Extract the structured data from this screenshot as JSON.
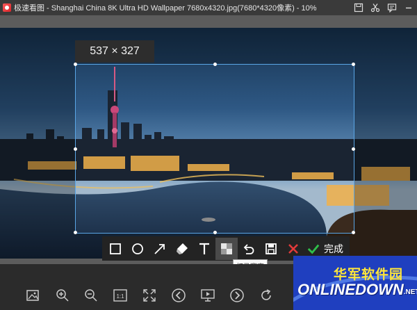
{
  "titlebar": {
    "title": "极速看图 - Shanghai China 8K Ultra HD Wallpaper 7680x4320.jpg(7680*4320像素) - 10%",
    "icons": [
      "save-icon",
      "crop-icon",
      "comment-icon",
      "minimize-icon"
    ]
  },
  "selection": {
    "size_label": "537 × 327"
  },
  "toolbar": {
    "tools": [
      "rectangle-icon",
      "ellipse-icon",
      "arrow-icon",
      "brush-icon",
      "text-icon",
      "mosaic-icon",
      "undo-icon",
      "save-icon",
      "cancel-icon"
    ],
    "done_label": "完成",
    "tooltip": "打马赛克"
  },
  "bottom_bar": {
    "icons": [
      "image-icon",
      "zoom-in-icon",
      "zoom-out-icon",
      "actual-size-icon",
      "fit-window-icon",
      "previous-icon",
      "slideshow-icon",
      "next-icon",
      "rotate-icon"
    ],
    "actual_size_label": "1:1"
  },
  "watermark": {
    "title": "华军软件园",
    "logo": "ONLINEDOWN",
    "suffix": ".NET"
  },
  "colors": {
    "selection_border": "#5aa6e6",
    "cancel": "#e23a3a",
    "done_check": "#2fbf4a",
    "watermark_title": "#ffe63a",
    "watermark_bg": "#1f3fbf"
  }
}
